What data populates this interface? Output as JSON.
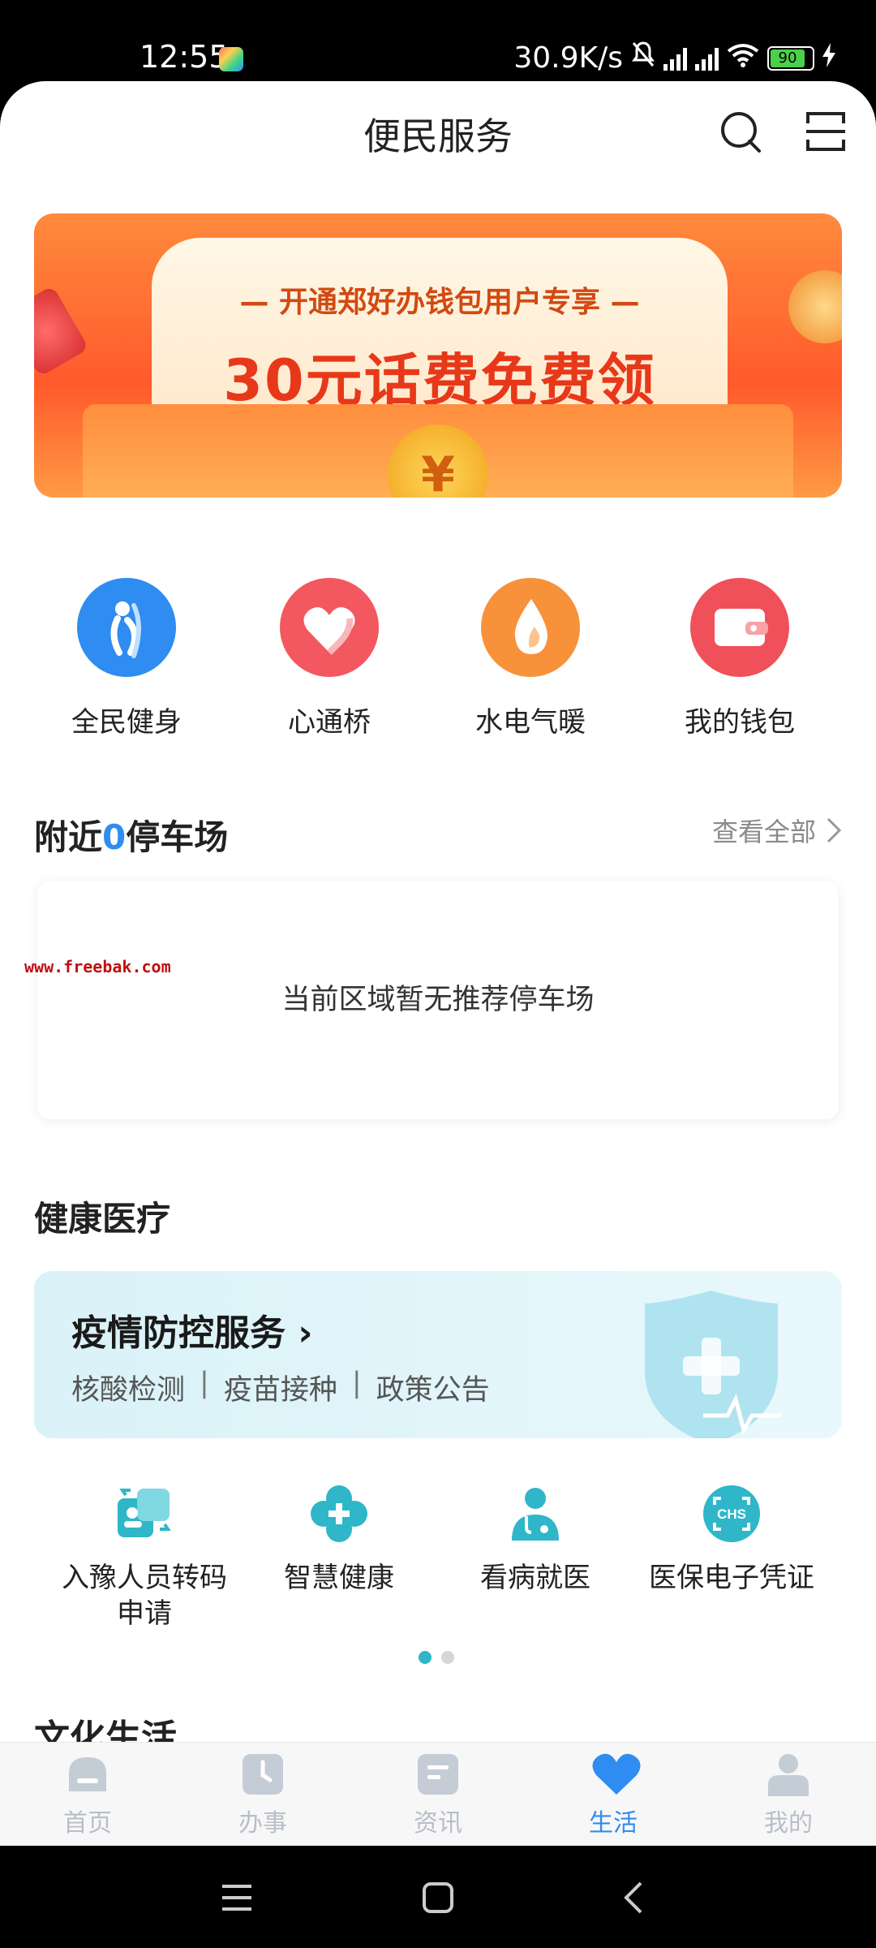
{
  "status_bar": {
    "time": "12:55",
    "net_speed": "30.9K/s",
    "battery": "90"
  },
  "header": {
    "title": "便民服务"
  },
  "banner": {
    "subtitle": "开通郑好办钱包用户专享",
    "headline": "30元话费免费领",
    "coin_symbol": "¥"
  },
  "quick_services": [
    {
      "label": "全民健身",
      "icon": "fitness-icon",
      "color": "#2f8cf0"
    },
    {
      "label": "心通桥",
      "icon": "heart-bridge-icon",
      "color": "#f3575f"
    },
    {
      "label": "水电气暖",
      "icon": "utilities-flame-icon",
      "color": "#f7923b"
    },
    {
      "label": "我的钱包",
      "icon": "wallet-icon",
      "color": "#f0505a"
    }
  ],
  "parking": {
    "title_prefix": "附近",
    "count": "0",
    "title_suffix": "停车场",
    "view_all": "查看全部",
    "empty_message": "当前区域暂无推荐停车场"
  },
  "watermark": "www.freebak.com",
  "health": {
    "section_title": "健康医疗",
    "covid_card": {
      "title": "疫情防控服务",
      "arrow": "›",
      "links": [
        "核酸检测",
        "疫苗接种",
        "政策公告"
      ]
    },
    "items": [
      {
        "label_line1": "入豫人员转码",
        "label_line2": "申请",
        "icon": "transfer-code-icon"
      },
      {
        "label_line1": "智慧健康",
        "label_line2": "",
        "icon": "smart-health-icon"
      },
      {
        "label_line1": "看病就医",
        "label_line2": "",
        "icon": "doctor-icon"
      },
      {
        "label_line1": "医保电子凭证",
        "label_line2": "",
        "icon": "chs-insurance-icon"
      }
    ],
    "page_dots": 2,
    "active_dot": 0
  },
  "culture": {
    "section_title": "文化生活"
  },
  "tabbar": {
    "tabs": [
      {
        "label": "首页",
        "icon": "home-icon"
      },
      {
        "label": "办事",
        "icon": "clock-icon"
      },
      {
        "label": "资讯",
        "icon": "news-icon"
      },
      {
        "label": "生活",
        "icon": "heart-icon"
      },
      {
        "label": "我的",
        "icon": "profile-icon"
      }
    ],
    "active_index": 3,
    "accent_color": "#2f8cf0",
    "inactive_color": "#b8bec8"
  }
}
